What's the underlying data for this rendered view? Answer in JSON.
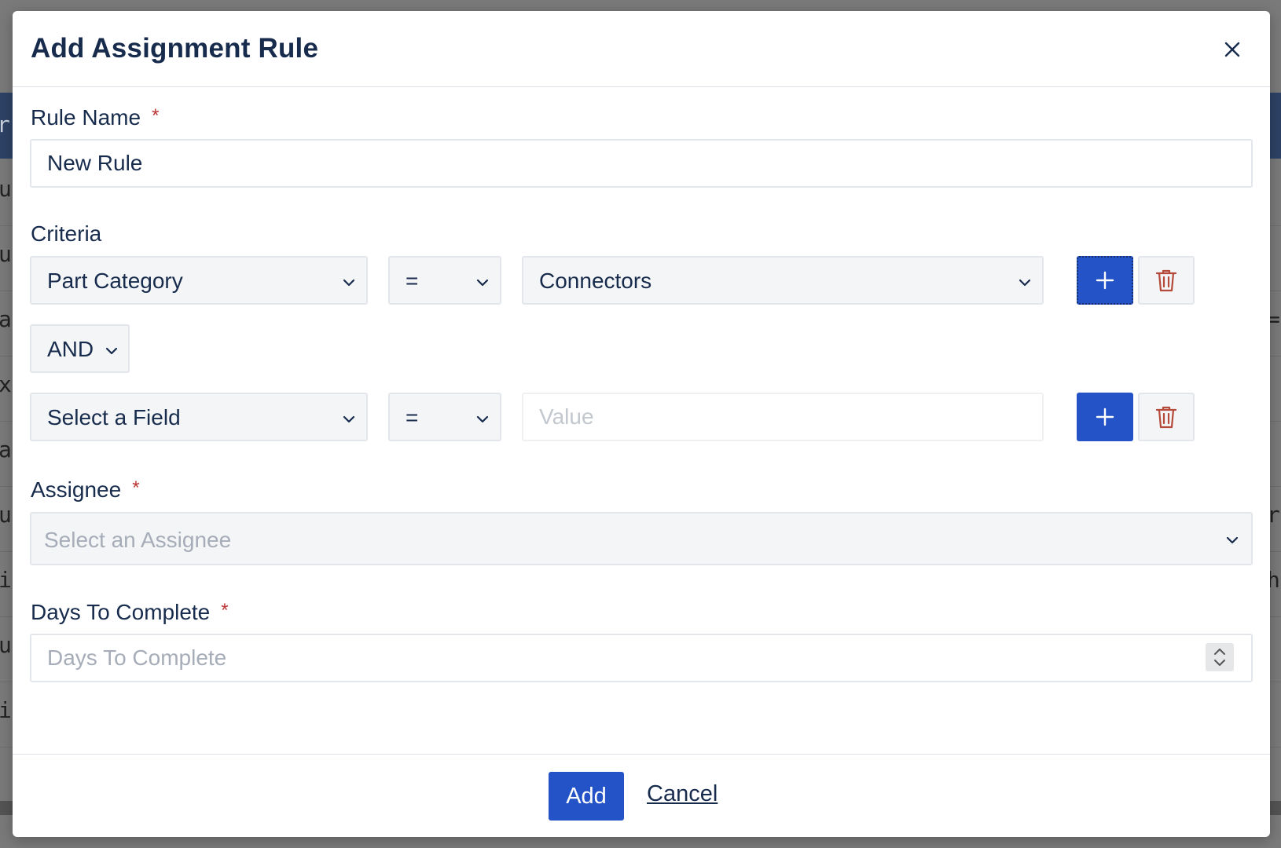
{
  "background": {
    "header_fragment": "r",
    "row_left_fragments": [
      "u",
      "u",
      "a",
      "x",
      "a",
      "u",
      "i",
      "u",
      "i"
    ],
    "row_right_fragments": [
      "",
      "",
      "=",
      "",
      "",
      "r",
      "h",
      "",
      ""
    ]
  },
  "modal": {
    "title": "Add Assignment Rule",
    "close_icon": "close-icon",
    "rule_name": {
      "label": "Rule Name",
      "required_mark": "*",
      "value": "New Rule"
    },
    "criteria": {
      "label": "Criteria",
      "rows": [
        {
          "field": "Part Category",
          "operator": "=",
          "value": "Connectors",
          "value_is_select": true
        },
        {
          "field": "Select a Field",
          "operator": "=",
          "value": "",
          "value_placeholder": "Value",
          "value_is_select": false
        }
      ],
      "conjunction": "AND",
      "add_icon": "plus-icon",
      "delete_icon": "trash-icon"
    },
    "assignee": {
      "label": "Assignee",
      "required_mark": "*",
      "placeholder": "Select an Assignee"
    },
    "days_to_complete": {
      "label": "Days To Complete",
      "required_mark": "*",
      "placeholder": "Days To Complete"
    },
    "footer": {
      "add_label": "Add",
      "cancel_label": "Cancel"
    }
  },
  "colors": {
    "primary": "#2453c7",
    "text": "#172b4d",
    "required": "#b33333",
    "delete_icon": "#b54a3a"
  }
}
